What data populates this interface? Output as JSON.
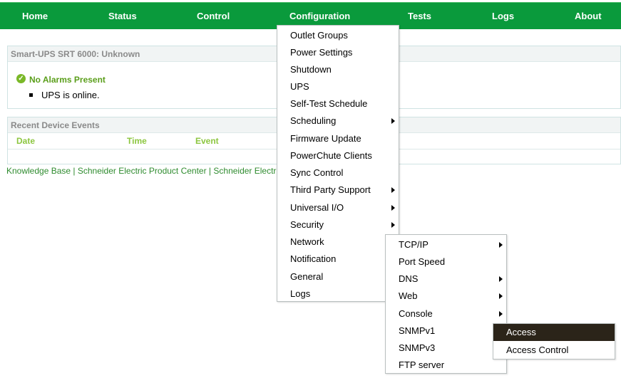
{
  "nav": {
    "items": [
      "Home",
      "Status",
      "Control",
      "Configuration",
      "Tests",
      "Logs",
      "About"
    ]
  },
  "status_panel": {
    "title": "Smart-UPS SRT 6000: Unknown",
    "alarm_text": "No Alarms Present",
    "status_text": "UPS is online."
  },
  "events_panel": {
    "title": "Recent Device Events",
    "columns": [
      "Date",
      "Time",
      "Event"
    ]
  },
  "footer": {
    "links_text": "Knowledge Base | Schneider Electric Product Center | Schneider Electric"
  },
  "config_menu": {
    "items": [
      "Outlet Groups",
      "Power Settings",
      "Shutdown",
      "UPS",
      "Self-Test Schedule",
      "Scheduling",
      "Firmware Update",
      "PowerChute Clients",
      "Sync Control",
      "Third Party Support",
      "Universal I/O",
      "Security",
      "Network",
      "Notification",
      "General",
      "Logs"
    ]
  },
  "network_menu": {
    "items": [
      "TCP/IP",
      "Port Speed",
      "DNS",
      "Web",
      "Console",
      "SNMPv1",
      "SNMPv3",
      "FTP server"
    ]
  },
  "snmp_menu": {
    "items": [
      "Access",
      "Access Control"
    ],
    "highlighted": "Access"
  },
  "colors": {
    "nav_green": "#0a9a3c",
    "highlight_bg": "#2b2419",
    "column_green": "#8cc63f",
    "alarm_green": "#5a9e1a",
    "link_green": "#2e8b2e"
  }
}
